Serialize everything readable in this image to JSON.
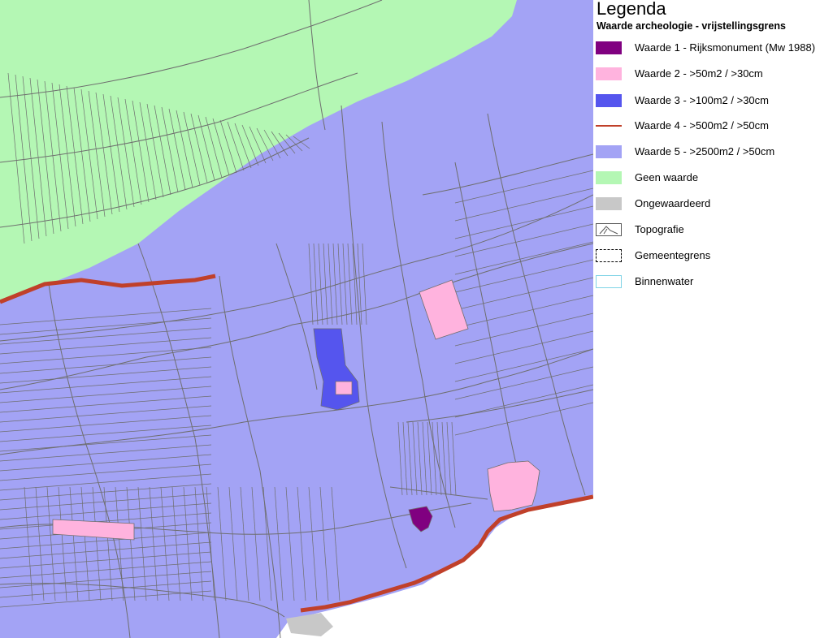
{
  "legend": {
    "title": "Legenda",
    "subtitle": "Waarde archeologie - vrijstellingsgrens",
    "items": [
      {
        "label": "Waarde 1 - Rijksmonument (Mw 1988)",
        "symbol": "fill",
        "color": "#800080",
        "icon": "purple-swatch-icon"
      },
      {
        "label": "Waarde 2 - >50m2 / >30cm",
        "symbol": "fill",
        "color": "#ffb3de",
        "icon": "pink-swatch-icon"
      },
      {
        "label": "Waarde 3 - >100m2 / >30cm",
        "symbol": "fill",
        "color": "#5555ee",
        "icon": "blue-swatch-icon"
      },
      {
        "label": "Waarde 4 - >500m2 / >50cm",
        "symbol": "line",
        "color": "#c0402a",
        "icon": "red-line-icon"
      },
      {
        "label": "Waarde 5 - >2500m2 / >50cm",
        "symbol": "fill",
        "color": "#a3a3f5",
        "icon": "lavender-swatch-icon"
      },
      {
        "label": "Geen waarde",
        "symbol": "fill",
        "color": "#b4f7b4",
        "icon": "green-swatch-icon"
      },
      {
        "label": "Ongewaardeerd",
        "symbol": "fill",
        "color": "#c8c8c8",
        "icon": "grey-swatch-icon"
      },
      {
        "label": "Topografie",
        "symbol": "topo",
        "color": "#555555",
        "icon": "topography-icon"
      },
      {
        "label": "Gemeentegrens",
        "symbol": "dashed",
        "color": "#000000",
        "icon": "municipal-border-icon"
      },
      {
        "label": "Binnenwater",
        "symbol": "outline",
        "color": "#7fd3e6",
        "icon": "inland-water-icon"
      }
    ]
  },
  "map": {
    "colors": {
      "waarde5": "#a3a3f5",
      "geen_waarde": "#b4f7b4",
      "waarde2": "#ffb3de",
      "waarde3": "#5555ee",
      "waarde1": "#800080",
      "waarde4_line": "#c0402a",
      "ongewaardeerd": "#c8c8c8",
      "parcel_lines": "#6e6e6e"
    }
  }
}
